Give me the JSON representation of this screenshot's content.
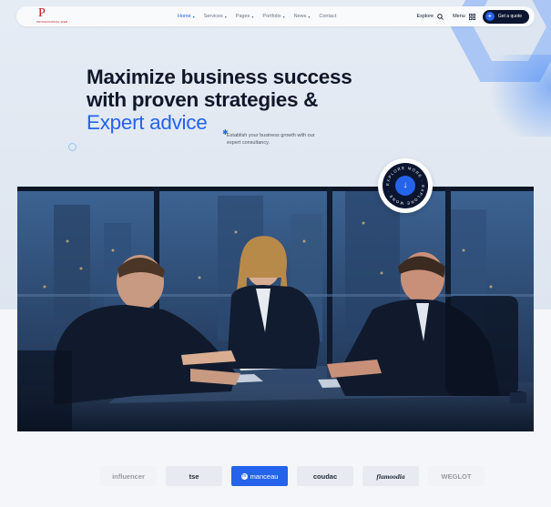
{
  "brand": {
    "letter": "P",
    "tagline": "PROFESSIONAL WEB"
  },
  "nav": {
    "items": [
      {
        "label": "Home",
        "active": true,
        "has_dropdown": true
      },
      {
        "label": "Services",
        "active": false,
        "has_dropdown": true
      },
      {
        "label": "Pages",
        "active": false,
        "has_dropdown": true
      },
      {
        "label": "Portfolio",
        "active": false,
        "has_dropdown": true
      },
      {
        "label": "News",
        "active": false,
        "has_dropdown": true
      },
      {
        "label": "Contact",
        "active": false,
        "has_dropdown": false
      }
    ],
    "explore_label": "Explore",
    "menu_label": "Menu",
    "cta_label": "Get a quote"
  },
  "hero": {
    "line1": "Maximize business success",
    "line2": "with proven strategies &",
    "line3": "Expert advice",
    "subtext": "Establish your business growth with our expert consultancy."
  },
  "badge": {
    "ring_text": "EXPLORE MORE · EXPLORE MORE ·",
    "icon": "arrow-down-icon"
  },
  "clients": [
    {
      "name": "influencer",
      "style": "faded"
    },
    {
      "name": "tse",
      "style": "normal"
    },
    {
      "name": "manceau",
      "style": "featured"
    },
    {
      "name": "coudac",
      "style": "normal"
    },
    {
      "name": "flamoodia",
      "style": "script"
    },
    {
      "name": "WEGLOT",
      "style": "faded"
    }
  ],
  "colors": {
    "accent": "#2563eb",
    "dark": "#0b1530",
    "brand_red": "#b91c1c"
  }
}
